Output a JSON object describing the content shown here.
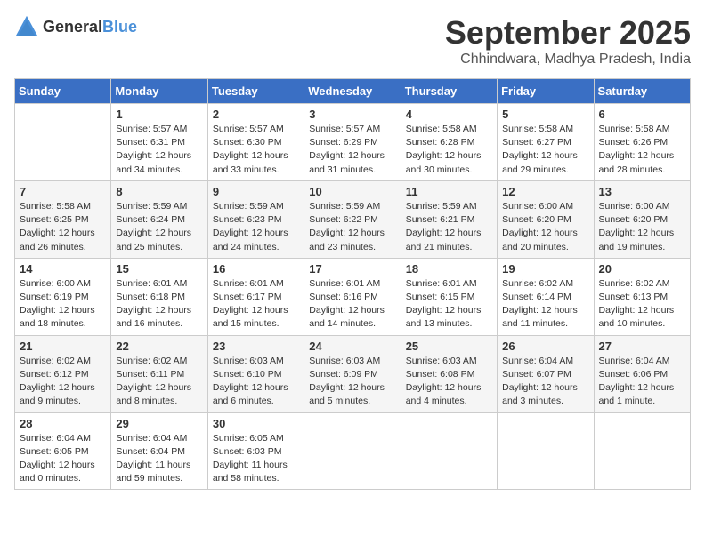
{
  "logo": {
    "general": "General",
    "blue": "Blue"
  },
  "title": {
    "month": "September 2025",
    "location": "Chhindwara, Madhya Pradesh, India"
  },
  "weekdays": [
    "Sunday",
    "Monday",
    "Tuesday",
    "Wednesday",
    "Thursday",
    "Friday",
    "Saturday"
  ],
  "weeks": [
    [
      {
        "day": "",
        "info": ""
      },
      {
        "day": "1",
        "info": "Sunrise: 5:57 AM\nSunset: 6:31 PM\nDaylight: 12 hours\nand 34 minutes."
      },
      {
        "day": "2",
        "info": "Sunrise: 5:57 AM\nSunset: 6:30 PM\nDaylight: 12 hours\nand 33 minutes."
      },
      {
        "day": "3",
        "info": "Sunrise: 5:57 AM\nSunset: 6:29 PM\nDaylight: 12 hours\nand 31 minutes."
      },
      {
        "day": "4",
        "info": "Sunrise: 5:58 AM\nSunset: 6:28 PM\nDaylight: 12 hours\nand 30 minutes."
      },
      {
        "day": "5",
        "info": "Sunrise: 5:58 AM\nSunset: 6:27 PM\nDaylight: 12 hours\nand 29 minutes."
      },
      {
        "day": "6",
        "info": "Sunrise: 5:58 AM\nSunset: 6:26 PM\nDaylight: 12 hours\nand 28 minutes."
      }
    ],
    [
      {
        "day": "7",
        "info": "Sunrise: 5:58 AM\nSunset: 6:25 PM\nDaylight: 12 hours\nand 26 minutes."
      },
      {
        "day": "8",
        "info": "Sunrise: 5:59 AM\nSunset: 6:24 PM\nDaylight: 12 hours\nand 25 minutes."
      },
      {
        "day": "9",
        "info": "Sunrise: 5:59 AM\nSunset: 6:23 PM\nDaylight: 12 hours\nand 24 minutes."
      },
      {
        "day": "10",
        "info": "Sunrise: 5:59 AM\nSunset: 6:22 PM\nDaylight: 12 hours\nand 23 minutes."
      },
      {
        "day": "11",
        "info": "Sunrise: 5:59 AM\nSunset: 6:21 PM\nDaylight: 12 hours\nand 21 minutes."
      },
      {
        "day": "12",
        "info": "Sunrise: 6:00 AM\nSunset: 6:20 PM\nDaylight: 12 hours\nand 20 minutes."
      },
      {
        "day": "13",
        "info": "Sunrise: 6:00 AM\nSunset: 6:20 PM\nDaylight: 12 hours\nand 19 minutes."
      }
    ],
    [
      {
        "day": "14",
        "info": "Sunrise: 6:00 AM\nSunset: 6:19 PM\nDaylight: 12 hours\nand 18 minutes."
      },
      {
        "day": "15",
        "info": "Sunrise: 6:01 AM\nSunset: 6:18 PM\nDaylight: 12 hours\nand 16 minutes."
      },
      {
        "day": "16",
        "info": "Sunrise: 6:01 AM\nSunset: 6:17 PM\nDaylight: 12 hours\nand 15 minutes."
      },
      {
        "day": "17",
        "info": "Sunrise: 6:01 AM\nSunset: 6:16 PM\nDaylight: 12 hours\nand 14 minutes."
      },
      {
        "day": "18",
        "info": "Sunrise: 6:01 AM\nSunset: 6:15 PM\nDaylight: 12 hours\nand 13 minutes."
      },
      {
        "day": "19",
        "info": "Sunrise: 6:02 AM\nSunset: 6:14 PM\nDaylight: 12 hours\nand 11 minutes."
      },
      {
        "day": "20",
        "info": "Sunrise: 6:02 AM\nSunset: 6:13 PM\nDaylight: 12 hours\nand 10 minutes."
      }
    ],
    [
      {
        "day": "21",
        "info": "Sunrise: 6:02 AM\nSunset: 6:12 PM\nDaylight: 12 hours\nand 9 minutes."
      },
      {
        "day": "22",
        "info": "Sunrise: 6:02 AM\nSunset: 6:11 PM\nDaylight: 12 hours\nand 8 minutes."
      },
      {
        "day": "23",
        "info": "Sunrise: 6:03 AM\nSunset: 6:10 PM\nDaylight: 12 hours\nand 6 minutes."
      },
      {
        "day": "24",
        "info": "Sunrise: 6:03 AM\nSunset: 6:09 PM\nDaylight: 12 hours\nand 5 minutes."
      },
      {
        "day": "25",
        "info": "Sunrise: 6:03 AM\nSunset: 6:08 PM\nDaylight: 12 hours\nand 4 minutes."
      },
      {
        "day": "26",
        "info": "Sunrise: 6:04 AM\nSunset: 6:07 PM\nDaylight: 12 hours\nand 3 minutes."
      },
      {
        "day": "27",
        "info": "Sunrise: 6:04 AM\nSunset: 6:06 PM\nDaylight: 12 hours\nand 1 minute."
      }
    ],
    [
      {
        "day": "28",
        "info": "Sunrise: 6:04 AM\nSunset: 6:05 PM\nDaylight: 12 hours\nand 0 minutes."
      },
      {
        "day": "29",
        "info": "Sunrise: 6:04 AM\nSunset: 6:04 PM\nDaylight: 11 hours\nand 59 minutes."
      },
      {
        "day": "30",
        "info": "Sunrise: 6:05 AM\nSunset: 6:03 PM\nDaylight: 11 hours\nand 58 minutes."
      },
      {
        "day": "",
        "info": ""
      },
      {
        "day": "",
        "info": ""
      },
      {
        "day": "",
        "info": ""
      },
      {
        "day": "",
        "info": ""
      }
    ]
  ]
}
